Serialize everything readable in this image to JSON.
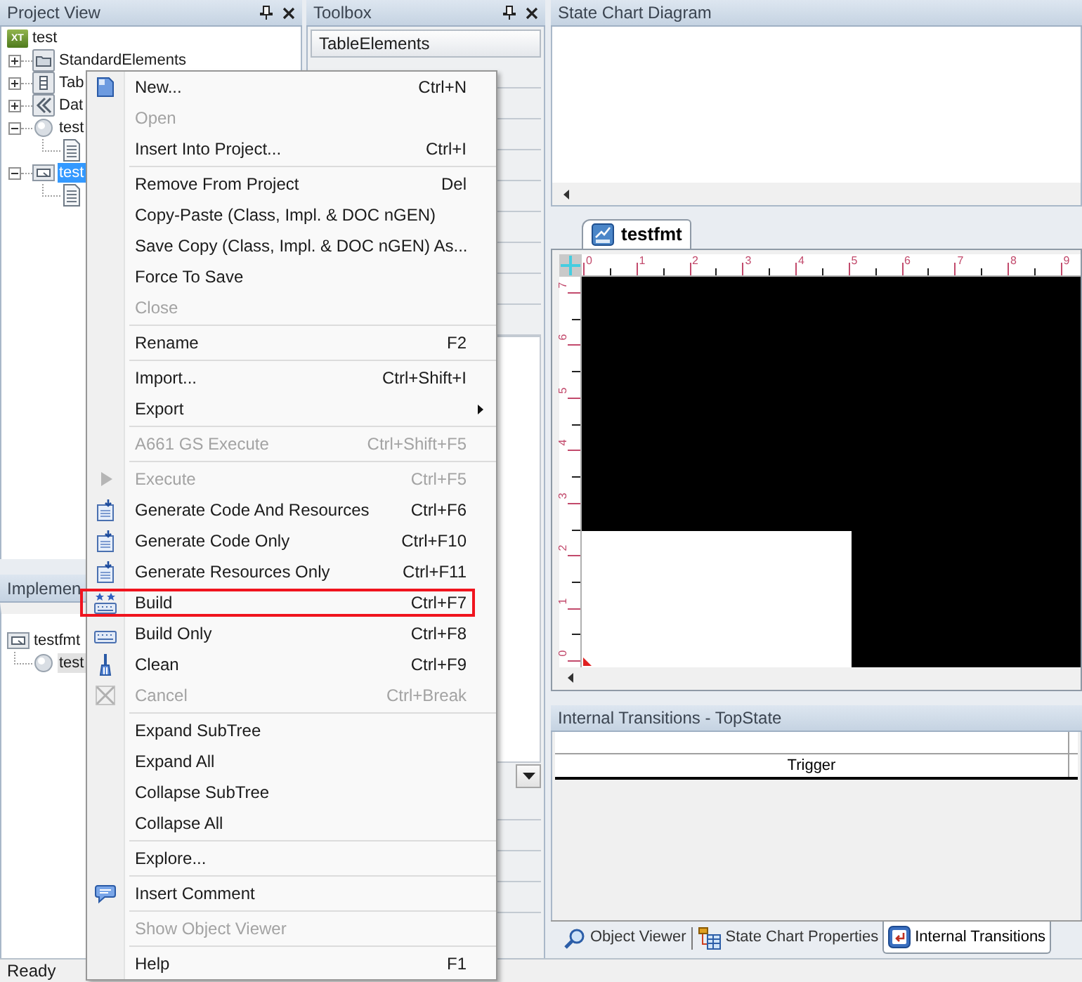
{
  "project_view": {
    "title": "Project View",
    "focused": true,
    "tree": [
      {
        "label": "test",
        "kind": "project",
        "icon_text": "XT",
        "selected": false,
        "children": [
          {
            "label": "StandardElements",
            "kind": "folder",
            "expanded": false,
            "selected": false
          },
          {
            "label": "Tab",
            "kind": "table",
            "expanded": false,
            "selected": false
          },
          {
            "label": "Dat",
            "kind": "data",
            "expanded": false,
            "selected": false
          },
          {
            "label": "test",
            "kind": "state",
            "expanded": true,
            "selected": false,
            "children": [
              {
                "kind": "document",
                "selected": false
              }
            ]
          },
          {
            "label": "test",
            "kind": "format",
            "expanded": true,
            "selected": true,
            "children": [
              {
                "kind": "document",
                "selected": false
              }
            ]
          }
        ]
      }
    ]
  },
  "toolbox": {
    "title": "Toolbox",
    "categories": [
      "TableElements"
    ]
  },
  "implementation_view": {
    "title": "Implemen",
    "focused": false,
    "tree": [
      {
        "label": "testfmt",
        "kind": "format",
        "selected": false,
        "children": [
          {
            "label": "test",
            "kind": "state",
            "selected": true
          }
        ]
      }
    ]
  },
  "state_chart_diagram": {
    "title": "State Chart Diagram"
  },
  "document_tabs": [
    {
      "label": "testfmt",
      "selected": true
    }
  ],
  "rulers": {
    "horizontal": [
      "0",
      "1",
      "2",
      "3",
      "4",
      "5",
      "6",
      "7",
      "8",
      "9"
    ],
    "vertical": [
      "7",
      "6",
      "5",
      "4",
      "3",
      "2",
      "1",
      "0"
    ]
  },
  "internal_transitions": {
    "title": "Internal Transitions - TopState",
    "columns": [
      "Trigger"
    ]
  },
  "bottom_tabs": [
    {
      "label": "Object Viewer",
      "kind": "viewer",
      "selected": false
    },
    {
      "label": "State Chart Properties",
      "kind": "properties",
      "selected": false
    },
    {
      "label": "Internal Transitions",
      "kind": "transitions",
      "selected": true
    }
  ],
  "status_bar": {
    "text": "Ready"
  },
  "context_menu": {
    "sections": [
      {
        "items": [
          {
            "label": "New...",
            "shortcut": "Ctrl+N",
            "kind": "document",
            "disabled": false,
            "submenu": false,
            "annotated": false
          },
          {
            "label": "Open",
            "kind": "text",
            "disabled": true,
            "submenu": false,
            "annotated": false
          },
          {
            "label": "Insert Into Project...",
            "shortcut": "Ctrl+I",
            "kind": "text",
            "disabled": false,
            "submenu": false,
            "annotated": false
          }
        ]
      },
      {
        "items": [
          {
            "label": "Remove From Project",
            "shortcut": "Del",
            "kind": "text",
            "disabled": false,
            "submenu": false,
            "annotated": false
          },
          {
            "label": "Copy-Paste (Class, Impl. & DOC nGEN)",
            "kind": "text",
            "disabled": false,
            "submenu": false,
            "annotated": false
          },
          {
            "label": "Save Copy (Class, Impl. & DOC nGEN) As...",
            "kind": "text",
            "disabled": false,
            "submenu": false,
            "annotated": false
          },
          {
            "label": "Force To Save",
            "kind": "text",
            "disabled": false,
            "submenu": false,
            "annotated": false
          },
          {
            "label": "Close",
            "kind": "text",
            "disabled": true,
            "submenu": false,
            "annotated": false
          }
        ]
      },
      {
        "items": [
          {
            "label": "Rename",
            "shortcut": "F2",
            "kind": "text",
            "disabled": false,
            "submenu": false,
            "annotated": false
          }
        ]
      },
      {
        "items": [
          {
            "label": "Import...",
            "shortcut": "Ctrl+Shift+I",
            "kind": "text",
            "disabled": false,
            "submenu": false,
            "annotated": false
          },
          {
            "label": "Export",
            "kind": "text",
            "disabled": false,
            "submenu": true,
            "annotated": false
          }
        ]
      },
      {
        "items": [
          {
            "label": "A661 GS Execute",
            "shortcut": "Ctrl+Shift+F5",
            "kind": "text",
            "disabled": true,
            "submenu": false,
            "annotated": false
          }
        ]
      },
      {
        "items": [
          {
            "label": "Execute",
            "shortcut": "Ctrl+F5",
            "kind": "play",
            "disabled": true,
            "submenu": false,
            "annotated": false
          },
          {
            "label": "Generate Code And Resources",
            "shortcut": "Ctrl+F6",
            "kind": "generate",
            "disabled": false,
            "submenu": false,
            "annotated": false
          },
          {
            "label": "Generate Code Only",
            "shortcut": "Ctrl+F10",
            "kind": "generate",
            "disabled": false,
            "submenu": false,
            "annotated": false
          },
          {
            "label": "Generate Resources Only",
            "shortcut": "Ctrl+F11",
            "kind": "generate",
            "disabled": false,
            "submenu": false,
            "annotated": false
          },
          {
            "label": "Build",
            "shortcut": "Ctrl+F7",
            "kind": "buildall",
            "disabled": false,
            "submenu": false,
            "annotated": true
          },
          {
            "label": "Build Only",
            "shortcut": "Ctrl+F8",
            "kind": "build",
            "disabled": false,
            "submenu": false,
            "annotated": false
          },
          {
            "label": "Clean",
            "shortcut": "Ctrl+F9",
            "kind": "broom",
            "disabled": false,
            "submenu": false,
            "annotated": false
          },
          {
            "label": "Cancel",
            "shortcut": "Ctrl+Break",
            "kind": "cancel",
            "disabled": true,
            "submenu": false,
            "annotated": false
          }
        ]
      },
      {
        "items": [
          {
            "label": "Expand SubTree",
            "kind": "text",
            "disabled": false,
            "submenu": false,
            "annotated": false
          },
          {
            "label": "Expand All",
            "kind": "text",
            "disabled": false,
            "submenu": false,
            "annotated": false
          },
          {
            "label": "Collapse SubTree",
            "kind": "text",
            "disabled": false,
            "submenu": false,
            "annotated": false
          },
          {
            "label": "Collapse All",
            "kind": "text",
            "disabled": false,
            "submenu": false,
            "annotated": false
          }
        ]
      },
      {
        "items": [
          {
            "label": "Explore...",
            "kind": "text",
            "disabled": false,
            "submenu": false,
            "annotated": false
          }
        ]
      },
      {
        "items": [
          {
            "label": "Insert Comment",
            "kind": "comment",
            "disabled": false,
            "submenu": false,
            "annotated": false
          }
        ]
      },
      {
        "items": [
          {
            "label": "Show Object Viewer",
            "kind": "text",
            "disabled": true,
            "submenu": false,
            "annotated": false
          }
        ]
      },
      {
        "items": [
          {
            "label": "Help",
            "shortcut": "F1",
            "kind": "text",
            "disabled": false,
            "submenu": false,
            "annotated": false
          }
        ]
      }
    ]
  }
}
